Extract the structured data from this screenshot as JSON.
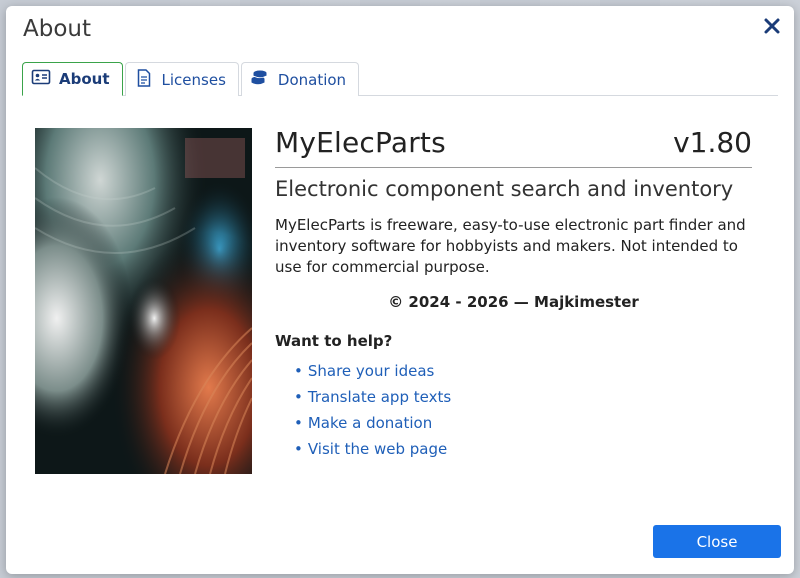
{
  "dialog": {
    "title": "About"
  },
  "tabs": [
    {
      "label": "About",
      "icon": "id-card-icon",
      "active": true
    },
    {
      "label": "Licenses",
      "icon": "document-icon",
      "active": false
    },
    {
      "label": "Donation",
      "icon": "coins-icon",
      "active": false
    }
  ],
  "app": {
    "name": "MyElecParts",
    "version": "v1.80",
    "subtitle": "Electronic component search and inventory",
    "description": "MyElecParts is freeware, easy-to-use electronic part finder and inventory software for hobbyists and makers. Not intended to use for commercial purpose.",
    "copyright": "© 2024 - 2026  —  Majkimester"
  },
  "help": {
    "title": "Want to help?",
    "links": [
      "Share your ideas",
      "Translate app texts",
      "Make a donation",
      "Visit the web page"
    ]
  },
  "footer": {
    "close_label": "Close"
  },
  "colors": {
    "accent": "#1a73e8",
    "link": "#1f5fb8",
    "active_tab_border": "#3aa34a"
  }
}
